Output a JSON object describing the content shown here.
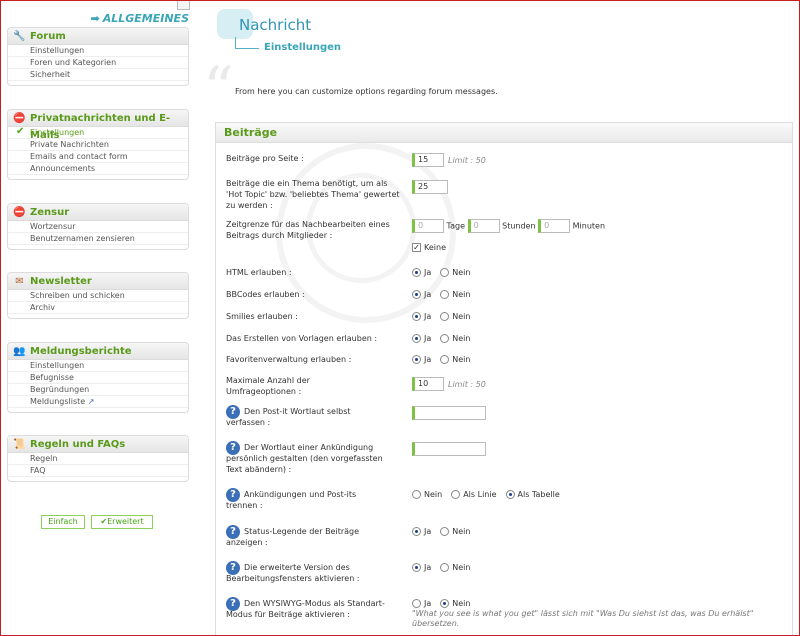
{
  "sidebar": {
    "header": "ALLGEMEINES",
    "sections": [
      {
        "title": "Forum",
        "icon": "tools-icon",
        "items": [
          "Einstellungen",
          "Foren und Kategorien",
          "Sicherheit"
        ]
      },
      {
        "title": "Privatnachrichten und E-Mails",
        "icon": "no-entry-icon",
        "items": [
          "Einstellungen",
          "Private Nachrichten",
          "Emails and contact form",
          "Announcements"
        ],
        "active": 0
      },
      {
        "title": "Zensur",
        "icon": "no-entry-icon",
        "items": [
          "Wortzensur",
          "Benutzernamen zensieren"
        ]
      },
      {
        "title": "Newsletter",
        "icon": "envelope-icon",
        "items": [
          "Schreiben und schicken",
          "Archiv"
        ]
      },
      {
        "title": "Meldungsberichte",
        "icon": "people-icon",
        "items": [
          "Einstellungen",
          "Befugnisse",
          "Begründungen",
          "Meldungsliste"
        ]
      },
      {
        "title": "Regeln und FAQs",
        "icon": "document-icon",
        "items": [
          "Regeln",
          "FAQ"
        ]
      }
    ],
    "buttons": {
      "simple": "Einfach",
      "advanced": "Erweitert"
    }
  },
  "page": {
    "title": "Nachricht",
    "subtitle": "Einstellungen",
    "intro": "From here you can customize options regarding forum messages."
  },
  "section": {
    "title": "Beiträge",
    "rows": {
      "posts_per_page": {
        "label": "Beiträge pro Seite :",
        "value": "15",
        "limit": "Limit : 50"
      },
      "hot_topic": {
        "label": "Beiträge die ein Thema benötigt, um als 'Hot Topic' bzw. 'beliebtes Thema' gewertet zu werden :",
        "value": "25"
      },
      "edit_time": {
        "label": "Zeitgrenze für das Nachbearbeiten eines Beitrags durch Mitglieder :",
        "days_value": "0",
        "days_unit": "Tage",
        "hours_value": "0",
        "hours_unit": "Stunden",
        "minutes_value": "0",
        "minutes_unit": "Minuten",
        "none_label": "Keine"
      },
      "html": {
        "label": "HTML erlauben :"
      },
      "bbcodes": {
        "label": "BBCodes erlauben :"
      },
      "smilies": {
        "label": "Smilies erlauben :"
      },
      "templates": {
        "label": "Das Erstellen von Vorlagen erlauben :"
      },
      "favorites": {
        "label": "Favoritenverwaltung erlauben :"
      },
      "poll_options": {
        "label": "Maximale Anzahl der Umfrageoptionen :",
        "value": "10",
        "limit": "Limit : 50"
      },
      "postit": {
        "label": "Den Post-it Wortlaut selbst verfassen :",
        "value": ""
      },
      "announcement": {
        "label": "Der Wortlaut einer Ankündigung persönlich gestalten (den vorgefassten Text abändern) :",
        "value": ""
      },
      "separate": {
        "label": "Ankündigungen und Post-its trennen :",
        "opt_no": "Nein",
        "opt_line": "Als Linie",
        "opt_table": "Als Tabelle"
      },
      "status_legend": {
        "label": "Status-Legende der Beiträge anzeigen :"
      },
      "extended_editor": {
        "label": "Die erweiterte Version des Bearbeitungsfensters aktivieren :"
      },
      "wysiwyg": {
        "label": "Den WYSIWYG-Modus als Standart-Modus für Beiträge aktivieren :",
        "note": "\"What you see is what you get\" lässt sich mit \"Was Du siehst ist das, was Du erhälst\" übersetzen."
      }
    },
    "yes": "Ja",
    "no": "Nein"
  },
  "colors": {
    "accent_green": "#5a9a1a",
    "accent_blue": "#2e96b7",
    "help_blue": "#3b6fb7",
    "frame_red": "#c82020"
  }
}
